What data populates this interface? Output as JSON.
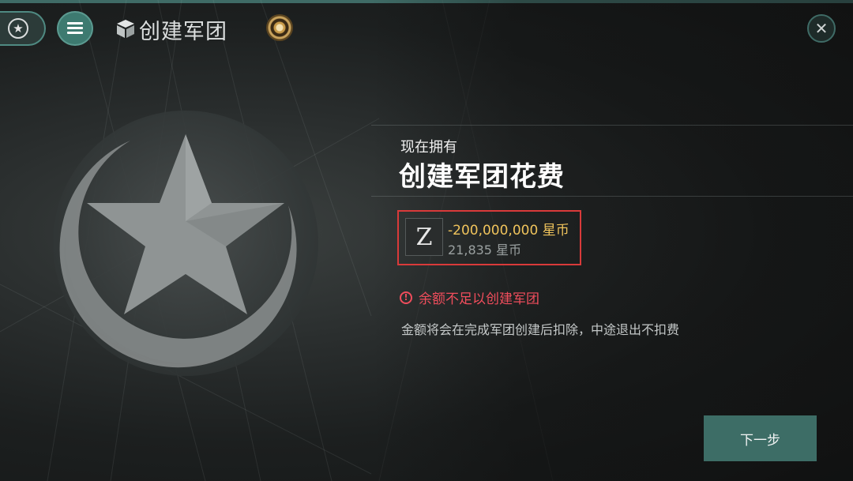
{
  "header": {
    "title": "创建军团",
    "icons": {
      "rank": "star-badge-icon",
      "menu": "menu-icon",
      "title": "cube-icon",
      "currency": "coin-icon",
      "close": "close-icon"
    }
  },
  "panel": {
    "subtitle": "现在拥有",
    "title": "创建军团花费",
    "currency_symbol": "Z",
    "cost": "-200,000,000 星币",
    "owned": "21,835 星币",
    "warning": "余额不足以创建军团",
    "note": "金额将会在完成军团创建后扣除，中途退出不扣费",
    "next_button": "下一步"
  },
  "colors": {
    "accent": "#3d6d66",
    "cost_text": "#f0c45c",
    "warning_text": "#f04d5c",
    "highlight_box": "#d93a3a"
  }
}
